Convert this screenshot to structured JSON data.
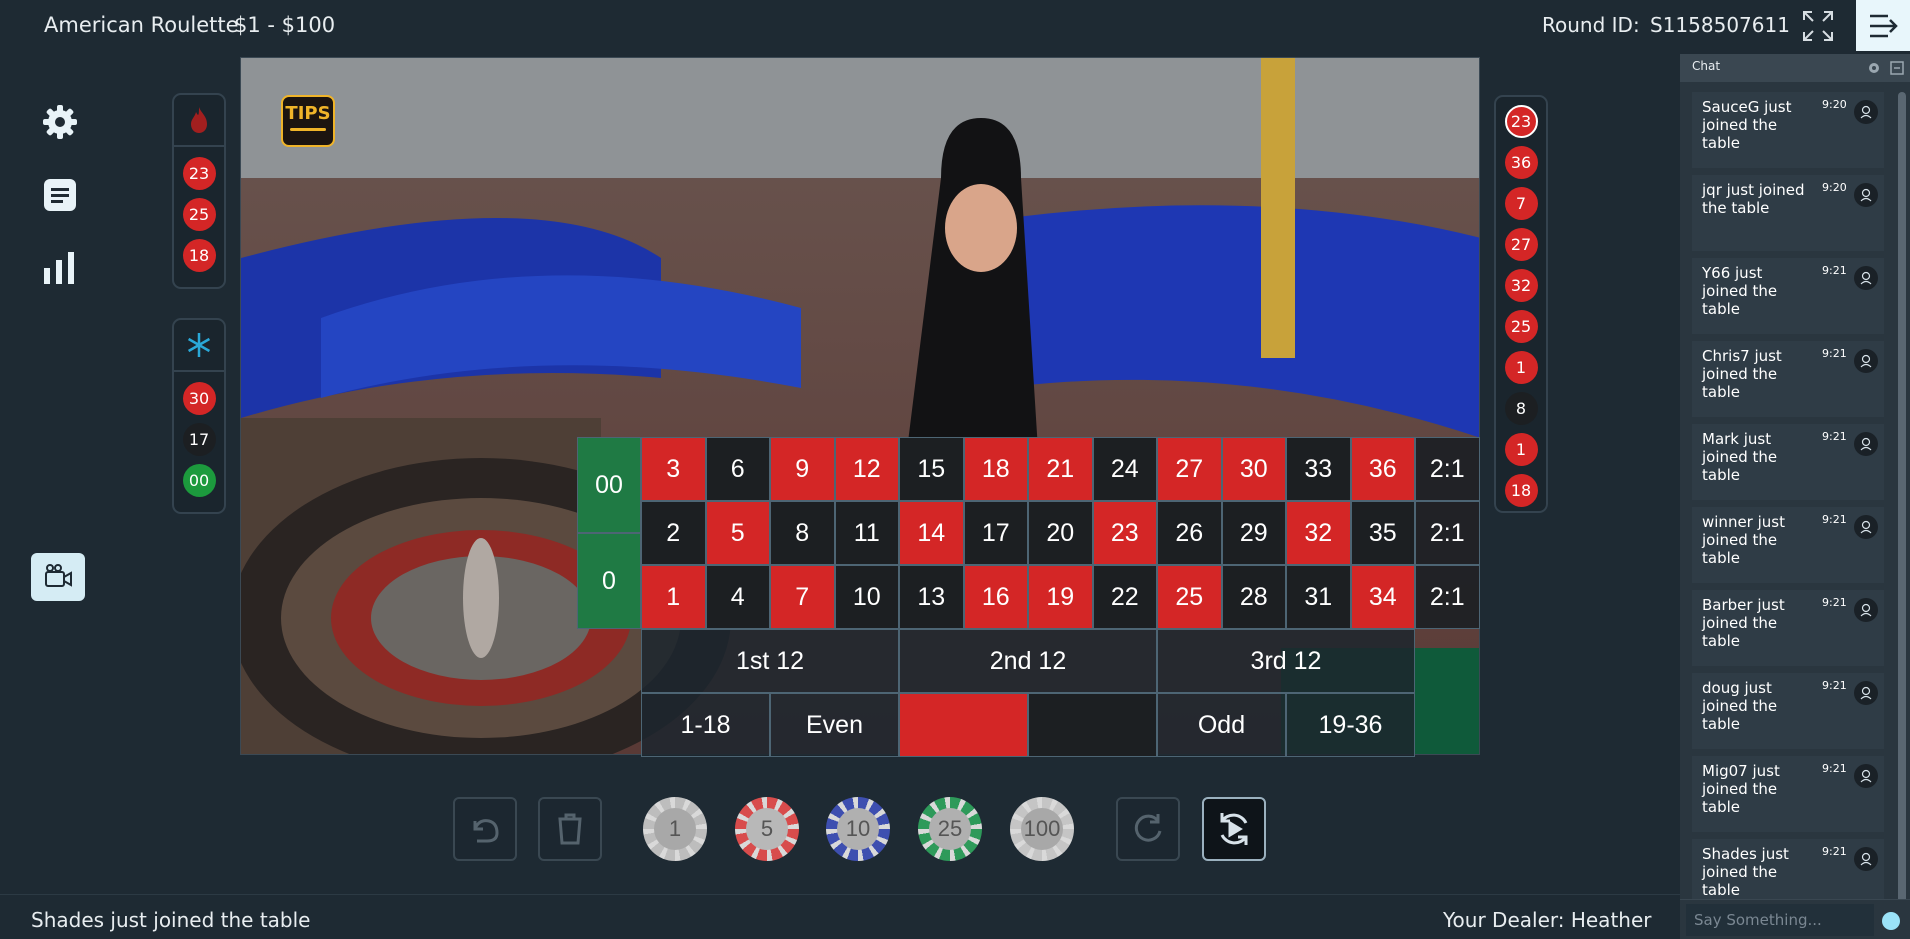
{
  "header": {
    "game_title": "American Roulette",
    "limits": "$1 - $100",
    "round_label": "Round ID:",
    "round_id": "S1158507611"
  },
  "tips_label": "TIPS",
  "hot_numbers": [
    {
      "n": "23",
      "c": "red"
    },
    {
      "n": "25",
      "c": "red"
    },
    {
      "n": "18",
      "c": "red"
    }
  ],
  "cold_numbers": [
    {
      "n": "30",
      "c": "red"
    },
    {
      "n": "17",
      "c": "black"
    },
    {
      "n": "00",
      "c": "green"
    }
  ],
  "recent_results": [
    {
      "n": "23",
      "c": "red"
    },
    {
      "n": "36",
      "c": "red"
    },
    {
      "n": "7",
      "c": "red"
    },
    {
      "n": "27",
      "c": "red"
    },
    {
      "n": "32",
      "c": "red"
    },
    {
      "n": "25",
      "c": "red"
    },
    {
      "n": "1",
      "c": "red"
    },
    {
      "n": "8",
      "c": "black"
    },
    {
      "n": "1",
      "c": "red"
    },
    {
      "n": "18",
      "c": "red"
    }
  ],
  "board": {
    "zeros": [
      "00",
      "0"
    ],
    "rows": [
      [
        {
          "n": "3",
          "c": "red"
        },
        {
          "n": "6",
          "c": "black"
        },
        {
          "n": "9",
          "c": "red"
        },
        {
          "n": "12",
          "c": "red"
        },
        {
          "n": "15",
          "c": "black"
        },
        {
          "n": "18",
          "c": "red"
        },
        {
          "n": "21",
          "c": "red"
        },
        {
          "n": "24",
          "c": "black"
        },
        {
          "n": "27",
          "c": "red"
        },
        {
          "n": "30",
          "c": "red"
        },
        {
          "n": "33",
          "c": "black"
        },
        {
          "n": "36",
          "c": "red"
        }
      ],
      [
        {
          "n": "2",
          "c": "black"
        },
        {
          "n": "5",
          "c": "red"
        },
        {
          "n": "8",
          "c": "black"
        },
        {
          "n": "11",
          "c": "black"
        },
        {
          "n": "14",
          "c": "red"
        },
        {
          "n": "17",
          "c": "black"
        },
        {
          "n": "20",
          "c": "black"
        },
        {
          "n": "23",
          "c": "red"
        },
        {
          "n": "26",
          "c": "black"
        },
        {
          "n": "29",
          "c": "black"
        },
        {
          "n": "32",
          "c": "red"
        },
        {
          "n": "35",
          "c": "black"
        }
      ],
      [
        {
          "n": "1",
          "c": "red"
        },
        {
          "n": "4",
          "c": "black"
        },
        {
          "n": "7",
          "c": "red"
        },
        {
          "n": "10",
          "c": "black"
        },
        {
          "n": "13",
          "c": "black"
        },
        {
          "n": "16",
          "c": "red"
        },
        {
          "n": "19",
          "c": "red"
        },
        {
          "n": "22",
          "c": "black"
        },
        {
          "n": "25",
          "c": "red"
        },
        {
          "n": "28",
          "c": "black"
        },
        {
          "n": "31",
          "c": "black"
        },
        {
          "n": "34",
          "c": "red"
        }
      ]
    ],
    "columns": [
      "2:1",
      "2:1",
      "2:1"
    ],
    "dozens": [
      "1st 12",
      "2nd 12",
      "3rd 12"
    ],
    "outside": [
      {
        "label": "1-18",
        "kind": "plain"
      },
      {
        "label": "Even",
        "kind": "plain"
      },
      {
        "label": "",
        "kind": "red"
      },
      {
        "label": "",
        "kind": "black"
      },
      {
        "label": "Odd",
        "kind": "plain"
      },
      {
        "label": "19-36",
        "kind": "plain"
      }
    ]
  },
  "chips": [
    {
      "value": "1",
      "ring": "#bdbdbd",
      "inner": "#a8a8a8"
    },
    {
      "value": "5",
      "ring": "#d84c4c",
      "inner": "#b8b8b8"
    },
    {
      "value": "10",
      "ring": "#3e4fb0",
      "inner": "#b0b0b0"
    },
    {
      "value": "25",
      "ring": "#2e9a5a",
      "inner": "#b0b0b0"
    },
    {
      "value": "100",
      "ring": "#c5c5c5",
      "inner": "#a8a8a8"
    }
  ],
  "status_message": "Shades just joined the table",
  "dealer_text": "Your Dealer: Heather",
  "chat": {
    "title": "Chat",
    "placeholder": "Say Something...",
    "messages": [
      {
        "text": "SauceG just joined the table",
        "time": "9:20"
      },
      {
        "text": "jqr just joined the table",
        "time": "9:20"
      },
      {
        "text": "Y66 just joined the table",
        "time": "9:21"
      },
      {
        "text": "Chris7 just joined the table",
        "time": "9:21"
      },
      {
        "text": "Mark just joined the table",
        "time": "9:21"
      },
      {
        "text": "winner just joined the table",
        "time": "9:21"
      },
      {
        "text": "Barber just joined the table",
        "time": "9:21"
      },
      {
        "text": "doug just joined the table",
        "time": "9:21"
      },
      {
        "text": "Mig07 just joined the table",
        "time": "9:21"
      },
      {
        "text": "Shades just joined the table",
        "time": "9:21"
      }
    ]
  },
  "colors": {
    "red": "#d42626",
    "black": "#1c1f22",
    "green": "#1f7a44",
    "accent": "#f0b429",
    "background": "#1e2a33"
  }
}
